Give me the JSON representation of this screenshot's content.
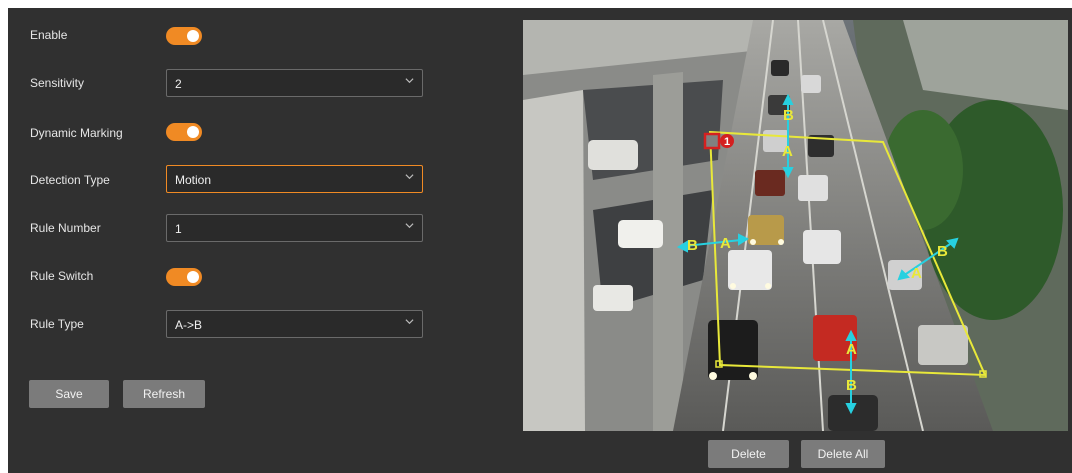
{
  "settings": {
    "enable_label": "Enable",
    "sensitivity_label": "Sensitivity",
    "sensitivity_value": "2",
    "dynamic_marking_label": "Dynamic Marking",
    "detection_type_label": "Detection Type",
    "detection_type_value": "Motion",
    "rule_number_label": "Rule Number",
    "rule_number_value": "1",
    "rule_switch_label": "Rule Switch",
    "rule_type_label": "Rule Type",
    "rule_type_value": "A->B"
  },
  "toggles": {
    "enable": true,
    "dynamic_marking": true,
    "rule_switch": true
  },
  "actions": {
    "save_label": "Save",
    "refresh_label": "Refresh",
    "delete_label": "Delete",
    "delete_all_label": "Delete All"
  },
  "overlay": {
    "rule_index": "1",
    "label_a": "A",
    "label_b": "B",
    "region_color": "#e8e83a",
    "arrow_color": "#27d0e0",
    "marker_color": "#d42020"
  },
  "colors": {
    "accent": "#f08a24",
    "panel_bg": "#303030",
    "button_bg": "#7b7b7b"
  }
}
